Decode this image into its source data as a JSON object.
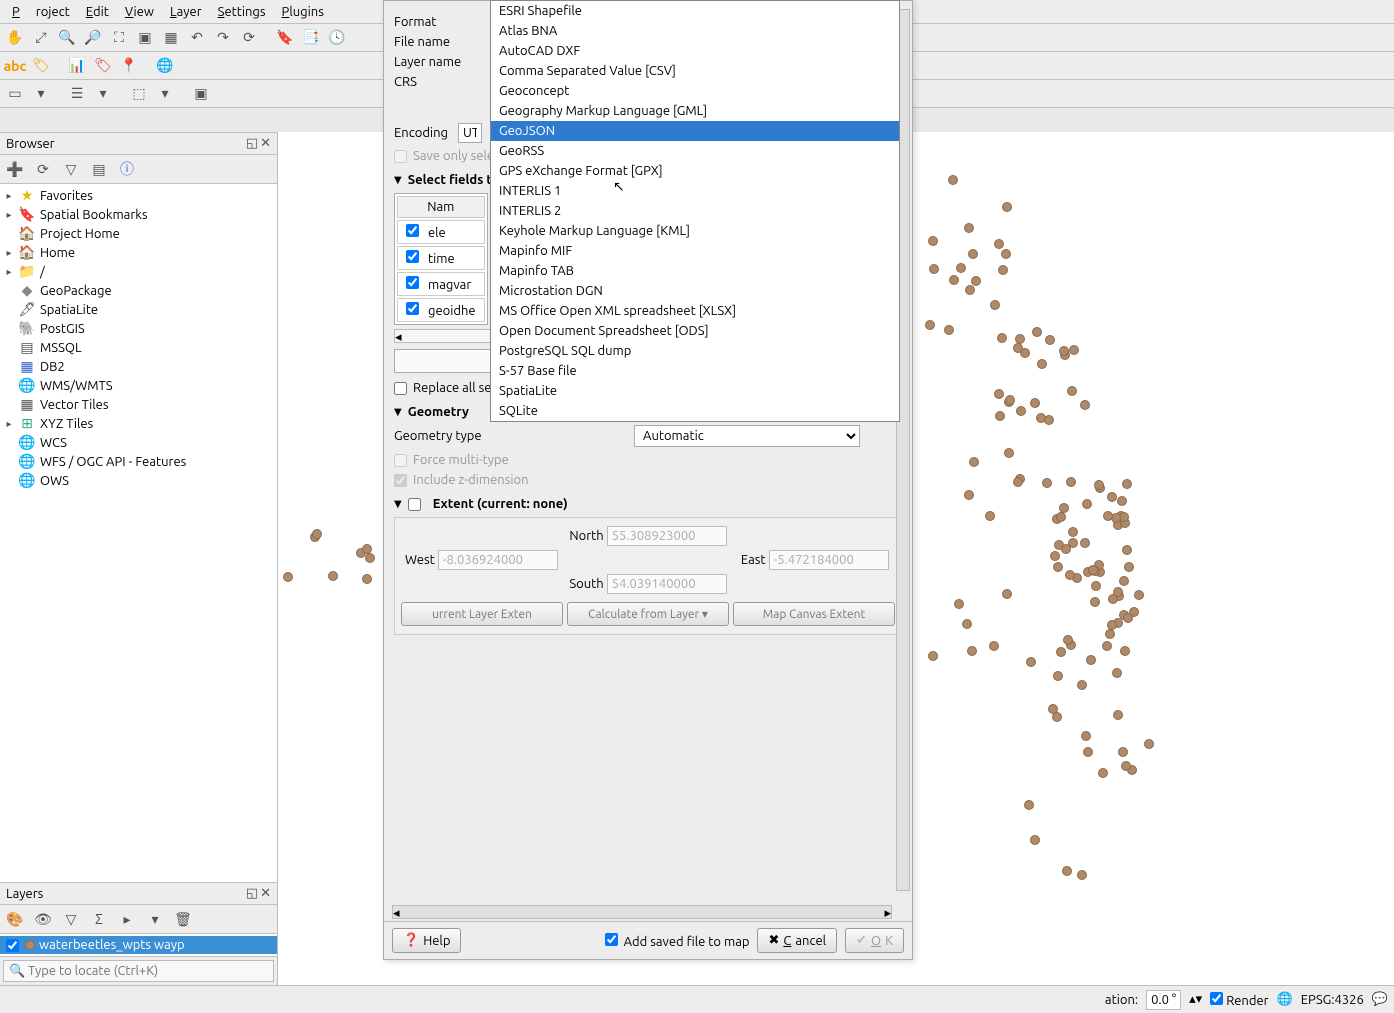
{
  "menubar": [
    "Project",
    "Edit",
    "View",
    "Layer",
    "Settings",
    "Plugins"
  ],
  "browser": {
    "title": "Browser",
    "items": [
      {
        "exp": "▸",
        "ico": "★",
        "label": "Favorites",
        "color": "#e6b800"
      },
      {
        "exp": "▸",
        "ico": "🔖",
        "label": "Spatial Bookmarks",
        "color": "#3a7"
      },
      {
        "exp": "",
        "ico": "🏠",
        "label": "Project Home",
        "color": "#888"
      },
      {
        "exp": "▸",
        "ico": "🏠",
        "label": "Home",
        "color": "#888"
      },
      {
        "exp": "▸",
        "ico": "📁",
        "label": "/",
        "color": "#888"
      },
      {
        "exp": "",
        "ico": "◆",
        "label": "GeoPackage",
        "color": "#888"
      },
      {
        "exp": "",
        "ico": "🖋",
        "label": "SpatiaLite",
        "color": "#555"
      },
      {
        "exp": "",
        "ico": "🐘",
        "label": "PostGIS",
        "color": "#369"
      },
      {
        "exp": "",
        "ico": "▤",
        "label": "MSSQL",
        "color": "#555"
      },
      {
        "exp": "",
        "ico": "▦",
        "label": "DB2",
        "color": "#36c"
      },
      {
        "exp": "",
        "ico": "🌐",
        "label": "WMS/WMTS",
        "color": "#3a7"
      },
      {
        "exp": "",
        "ico": "▦",
        "label": "Vector Tiles",
        "color": "#555"
      },
      {
        "exp": "▸",
        "ico": "⊞",
        "label": "XYZ Tiles",
        "color": "#3a7"
      },
      {
        "exp": "",
        "ico": "🌐",
        "label": "WCS",
        "color": "#3a7"
      },
      {
        "exp": "",
        "ico": "🌐",
        "label": "WFS / OGC API - Features",
        "color": "#3a7"
      },
      {
        "exp": "",
        "ico": "🌐",
        "label": "OWS",
        "color": "#3a7"
      }
    ]
  },
  "layers": {
    "title": "Layers",
    "selected": "waterbeetles_wpts wayp"
  },
  "locate_placeholder": "Type to locate (Ctrl+K)",
  "dialog": {
    "labels": {
      "format": "Format",
      "file_name": "File name",
      "layer_name": "Layer name",
      "crs": "CRS",
      "encoding": "Encoding",
      "save_only": "Save only selected features",
      "select_fields": "Select fields to export and their export options",
      "name_col": "Name",
      "replace_raw": "Replace all selected raw field values by displayed values",
      "geometry": "Geometry",
      "geom_type": "Geometry type",
      "geom_auto": "Automatic",
      "force_multi": "Force multi-type",
      "include_z": "Include z-dimension",
      "extent": "Extent (current: none)",
      "north": "North",
      "south": "South",
      "east": "East",
      "west": "West",
      "cur_layer_btn": "urrent Layer Exten",
      "calc_layer_btn": "Calculate from Layer ▾",
      "map_canvas_btn": "Map Canvas Extent",
      "help": "Help",
      "add_saved": "Add saved file to map",
      "cancel": "Cancel",
      "ok": "OK"
    },
    "encoding_value": "UT",
    "fields": [
      "ele",
      "time",
      "magvar",
      "geoidhe"
    ],
    "extent_values": {
      "north": "55.308923000",
      "south": "54.039140000",
      "east": "-5.472184000",
      "west": "-8.036924000"
    }
  },
  "dropdown": [
    "ESRI Shapefile",
    "Atlas BNA",
    "AutoCAD DXF",
    "Comma Separated Value [CSV]",
    "Geoconcept",
    "Geography Markup Language [GML]",
    "GeoJSON",
    "GeoRSS",
    "GPS eXchange Format [GPX]",
    "INTERLIS 1",
    "INTERLIS 2",
    "Keyhole Markup Language [KML]",
    "Mapinfo MIF",
    "Mapinfo TAB",
    "Microstation DGN",
    "MS Office Open XML spreadsheet [XLSX]",
    "Open Document Spreadsheet [ODS]",
    "PostgreSQL SQL dump",
    "S-57 Base file",
    "SpatiaLite",
    "SQLite"
  ],
  "dropdown_selected": "GeoJSON",
  "statusbar": {
    "rotation_label": "ation:",
    "rotation": "0.0 °",
    "render": "Render",
    "epsg": "EPSG:4326"
  }
}
